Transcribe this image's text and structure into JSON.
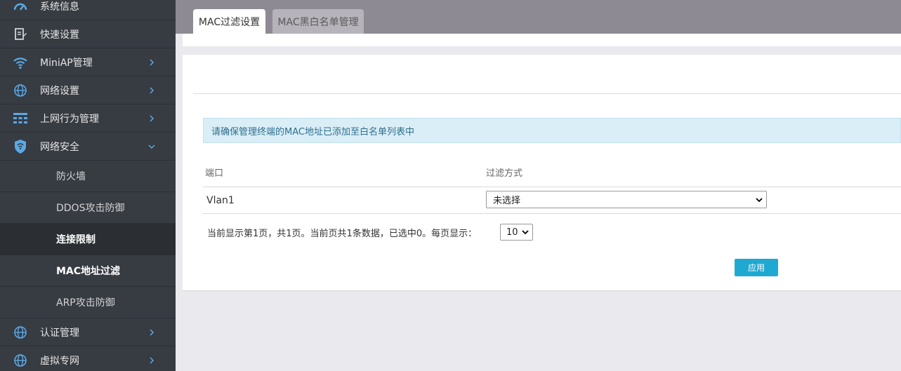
{
  "sidebar": {
    "items": [
      {
        "label": "系统信息",
        "icon": "dashboard-icon"
      },
      {
        "label": "快速设置",
        "icon": "edit-document-icon"
      },
      {
        "label": "MiniAP管理",
        "icon": "wifi-icon"
      },
      {
        "label": "网络设置",
        "icon": "globe-icon"
      },
      {
        "label": "上网行为管理",
        "icon": "grid-icon"
      },
      {
        "label": "网络安全",
        "icon": "shield-icon"
      },
      {
        "label": "认证管理",
        "icon": "globe-icon"
      },
      {
        "label": "虚拟专网",
        "icon": "globe-icon"
      }
    ],
    "submenu": [
      {
        "label": "防火墙"
      },
      {
        "label": "DDOS攻击防御"
      },
      {
        "label": "连接限制"
      },
      {
        "label": "MAC地址过滤"
      },
      {
        "label": "ARP攻击防御"
      }
    ]
  },
  "tabs": [
    {
      "label": "MAC过滤设置",
      "active": true
    },
    {
      "label": "MAC黑白名单管理",
      "active": false
    }
  ],
  "main": {
    "alert": "请确保管理终端的MAC地址已添加至白名单列表中",
    "table": {
      "headers": [
        "端口",
        "过滤方式"
      ],
      "rows": [
        {
          "port": "Vlan1",
          "filter": "未选择"
        }
      ]
    },
    "pager": {
      "text": "当前显示第1页，共1页。当前页共1条数据，已选中0。每页显示：",
      "per_page": "10"
    },
    "apply_label": "应用"
  },
  "colors": {
    "sidebar_bg": "#373b42",
    "tabbar_bg": "#8d8a93",
    "accent": "#1fa9d2",
    "alert_bg": "#d9eef6"
  }
}
